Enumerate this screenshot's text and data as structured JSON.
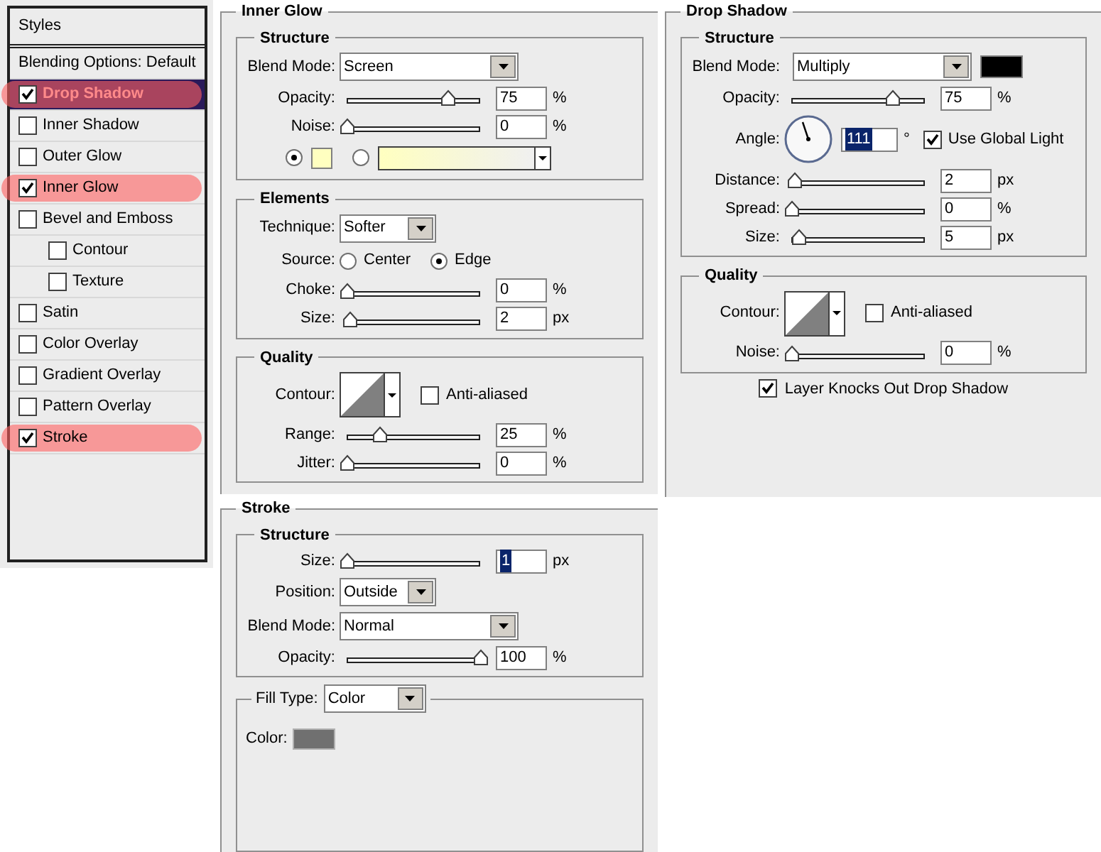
{
  "styles_panel": {
    "title": "Styles",
    "items": [
      {
        "label": "Blending Options: Default",
        "kind": "plain",
        "selected": false,
        "highlighted": false
      },
      {
        "label": "Drop Shadow",
        "kind": "checkbox",
        "checked": true,
        "selected": true,
        "highlighted": true
      },
      {
        "label": "Inner Shadow",
        "kind": "checkbox",
        "checked": false,
        "selected": false,
        "highlighted": false
      },
      {
        "label": "Outer Glow",
        "kind": "checkbox",
        "checked": false,
        "selected": false,
        "highlighted": false
      },
      {
        "label": "Inner Glow",
        "kind": "checkbox",
        "checked": true,
        "selected": false,
        "highlighted": true
      },
      {
        "label": "Bevel and Emboss",
        "kind": "checkbox",
        "checked": false,
        "selected": false,
        "highlighted": false,
        "children": [
          {
            "label": "Contour",
            "kind": "checkbox",
            "checked": false,
            "selected": false,
            "highlighted": false
          },
          {
            "label": "Texture",
            "kind": "checkbox",
            "checked": false,
            "selected": false,
            "highlighted": false
          }
        ]
      },
      {
        "label": "Satin",
        "kind": "checkbox",
        "checked": false,
        "selected": false,
        "highlighted": false
      },
      {
        "label": "Color Overlay",
        "kind": "checkbox",
        "checked": false,
        "selected": false,
        "highlighted": false
      },
      {
        "label": "Gradient Overlay",
        "kind": "checkbox",
        "checked": false,
        "selected": false,
        "highlighted": false
      },
      {
        "label": "Pattern Overlay",
        "kind": "checkbox",
        "checked": false,
        "selected": false,
        "highlighted": false
      },
      {
        "label": "Stroke",
        "kind": "checkbox",
        "checked": true,
        "selected": false,
        "highlighted": true
      }
    ]
  },
  "inner_glow": {
    "title": "Inner Glow",
    "sections": [
      {
        "kind": "titled",
        "title": "Structure",
        "rows": [
          {
            "kind": "select",
            "label": "Blend Mode:",
            "value": "Screen"
          },
          {
            "kind": "slider",
            "label": "Opacity:",
            "level": 0.75,
            "value": "75",
            "unit": "%",
            "text_selected": false
          },
          {
            "kind": "slider",
            "label": "Noise:",
            "level": 0,
            "value": "0",
            "unit": "%",
            "text_selected": false
          },
          {
            "kind": "color_choice",
            "options": [
              {
                "kind": "swatch",
                "selected": true,
                "color": "#ffffc0"
              },
              {
                "kind": "gradient",
                "selected": false,
                "color": "#ffffc0"
              }
            ]
          }
        ]
      },
      {
        "kind": "titled",
        "title": "Elements",
        "rows": [
          {
            "kind": "short_select",
            "label": "Technique:",
            "value": "Softer"
          },
          {
            "kind": "radio_group",
            "label": "Source:",
            "options": [
              {
                "label": "Center",
                "selected": false
              },
              {
                "label": "Edge",
                "selected": true
              }
            ]
          },
          {
            "kind": "slider",
            "label": "Choke:",
            "level": 0,
            "value": "0",
            "unit": "%",
            "text_selected": false
          },
          {
            "kind": "slider",
            "label": "Size:",
            "level": 0.02,
            "value": "2",
            "unit": "px",
            "text_selected": false
          }
        ]
      },
      {
        "kind": "titled",
        "title": "Quality",
        "rows": [
          {
            "kind": "contour",
            "label": "Contour:",
            "option": {
              "label": "Anti-aliased",
              "checked": false
            }
          },
          {
            "kind": "slider",
            "label": "Range:",
            "level": 0.24,
            "value": "25",
            "unit": "%",
            "text_selected": false
          },
          {
            "kind": "slider",
            "label": "Jitter:",
            "level": 0,
            "value": "0",
            "unit": "%",
            "text_selected": false
          }
        ]
      }
    ]
  },
  "drop_shadow": {
    "title": "Drop Shadow",
    "sections": [
      {
        "kind": "titled",
        "title": "Structure",
        "rows": [
          {
            "kind": "select_swatch",
            "label": "Blend Mode:",
            "value": "Multiply",
            "color": "#000000"
          },
          {
            "kind": "slider",
            "label": "Opacity:",
            "level": 0.75,
            "value": "75",
            "unit": "%",
            "text_selected": false
          },
          {
            "kind": "angle",
            "label": "Angle:",
            "value": "111",
            "unit": "°",
            "text_selected": true,
            "option": {
              "label": "Use Global Light",
              "checked": true
            }
          },
          {
            "kind": "slider",
            "label": "Distance:",
            "level": 0.02,
            "value": "2",
            "unit": "px",
            "text_selected": false
          },
          {
            "kind": "slider",
            "label": "Spread:",
            "level": 0,
            "value": "0",
            "unit": "%",
            "text_selected": false
          },
          {
            "kind": "slider",
            "label": "Size:",
            "level": 0.05,
            "value": "5",
            "unit": "px",
            "text_selected": false
          }
        ]
      },
      {
        "kind": "titled",
        "title": "Quality",
        "rows": [
          {
            "kind": "contour",
            "label": "Contour:",
            "option": {
              "label": "Anti-aliased",
              "checked": false
            }
          },
          {
            "kind": "slider",
            "label": "Noise:",
            "level": 0,
            "value": "0",
            "unit": "%",
            "text_selected": false
          }
        ]
      }
    ],
    "footer": {
      "label": "Layer Knocks Out Drop Shadow",
      "checked": true
    }
  },
  "stroke": {
    "title": "Stroke",
    "sections": [
      {
        "kind": "titled",
        "title": "Structure",
        "rows": [
          {
            "kind": "slider",
            "label": "Size:",
            "level": 0,
            "value": "1",
            "unit": "px",
            "text_selected": true
          },
          {
            "kind": "short_select",
            "label": "Position:",
            "value": "Outside"
          },
          {
            "kind": "select",
            "label": "Blend Mode:",
            "value": "Normal"
          },
          {
            "kind": "slider",
            "label": "Opacity:",
            "level": 1,
            "value": "100",
            "unit": "%",
            "text_selected": false
          }
        ]
      },
      {
        "kind": "select_legend",
        "label": "Fill Type:",
        "value": "Color",
        "rows": [
          {
            "kind": "swatch",
            "label": "Color:",
            "color": "#707070"
          }
        ]
      }
    ]
  }
}
